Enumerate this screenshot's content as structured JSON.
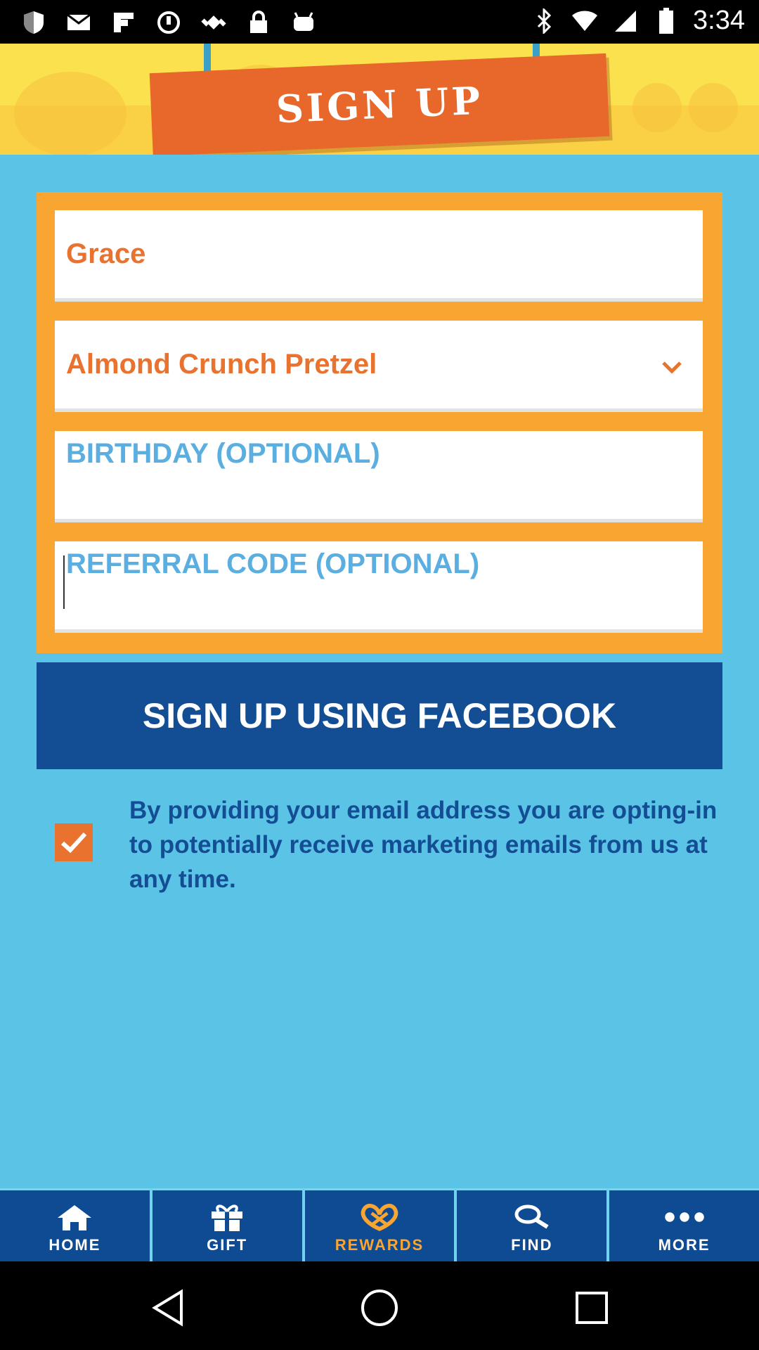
{
  "status_bar": {
    "time": "3:34",
    "icons": [
      "shield-icon",
      "mail-icon",
      "flipboard-icon",
      "circle-icon",
      "fake-gps-icon",
      "lock-icon",
      "android-icon",
      "bluetooth-icon",
      "wifi-icon",
      "signal-icon",
      "battery-icon"
    ]
  },
  "header": {
    "title": "SIGN UP"
  },
  "form": {
    "name_value": "Grace",
    "favorite_value": "Almond Crunch Pretzel",
    "birthday_placeholder": "BIRTHDAY (OPTIONAL)",
    "referral_placeholder": "REFERRAL CODE (OPTIONAL)"
  },
  "facebook_button": {
    "label": "SIGN UP USING FACEBOOK"
  },
  "optin": {
    "checked": true,
    "text": "By providing your email address you are opting-in to potentially receive marketing emails from us at any time."
  },
  "bottom_nav": {
    "items": [
      {
        "label": "HOME",
        "icon": "home-icon"
      },
      {
        "label": "GIFT",
        "icon": "gift-icon"
      },
      {
        "label": "REWARDS",
        "icon": "pretzel-icon",
        "active": true
      },
      {
        "label": "FIND",
        "icon": "search-icon"
      },
      {
        "label": "MORE",
        "icon": "more-icon"
      }
    ]
  },
  "colors": {
    "background": "#5bc4e6",
    "orange": "#f8a531",
    "accent_orange": "#e9722e",
    "navy": "#134d94",
    "header_yellow": "#fce14e"
  }
}
